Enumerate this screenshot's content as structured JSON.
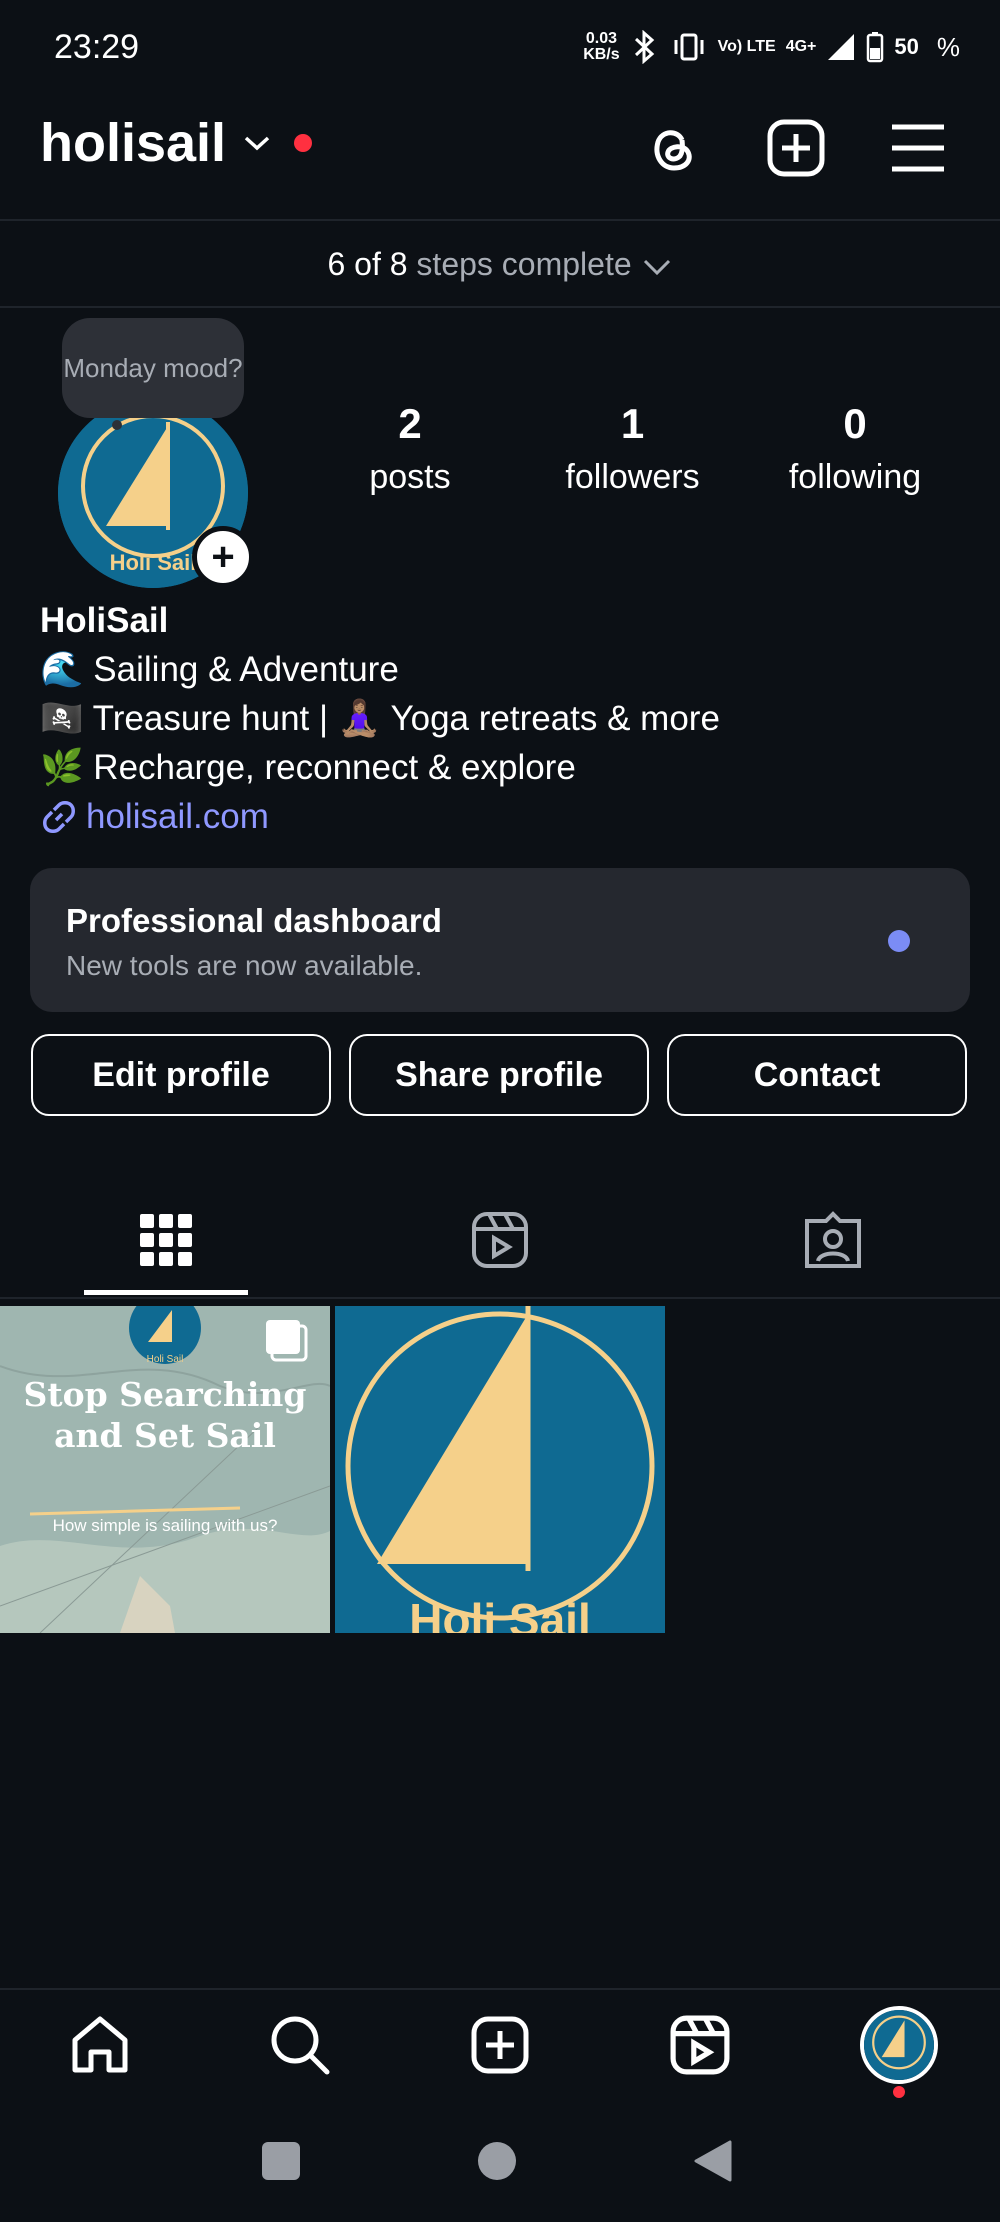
{
  "status_bar": {
    "time": "23:29",
    "net_speed_value": "0.03",
    "net_speed_unit": "KB/s",
    "volte": "Vo) LTE",
    "network": "4G+",
    "battery": "50",
    "battery_pct_symbol": "%"
  },
  "header": {
    "username": "holisail",
    "icons": [
      "threads-icon",
      "create-icon",
      "menu-icon"
    ]
  },
  "steps": {
    "count": "6 of 8",
    "text": "steps complete"
  },
  "note": {
    "text": "Monday mood?"
  },
  "stats": [
    {
      "num": "2",
      "label": "posts"
    },
    {
      "num": "1",
      "label": "followers"
    },
    {
      "num": "0",
      "label": "following"
    }
  ],
  "bio": {
    "name": "HoliSail",
    "line1": "🌊 Sailing & Adventure",
    "line2": "🏴‍☠️ Treasure hunt | 🧘🏽‍♀️ Yoga retreats &  more",
    "line3": "🌿 Recharge, reconnect & explore",
    "link": "holisail.com"
  },
  "dashboard": {
    "title": "Professional dashboard",
    "subtitle": "New tools are now available."
  },
  "buttons": {
    "edit": "Edit profile",
    "share": "Share profile",
    "contact": "Contact"
  },
  "posts": [
    {
      "title": "Stop Searching and Set Sail",
      "caption": "How simple is sailing with us?",
      "logo_text": "Holi Sail"
    },
    {
      "logo_text": "Holi Sail"
    }
  ],
  "avatar": {
    "logo_text": "Holi Sail"
  },
  "colors": {
    "background": "#0c1015",
    "card": "#25282f",
    "link": "#8f98ff",
    "notification": "#ff3040",
    "brand_blue": "#0f6a92",
    "brand_sail": "#f5d08a"
  }
}
